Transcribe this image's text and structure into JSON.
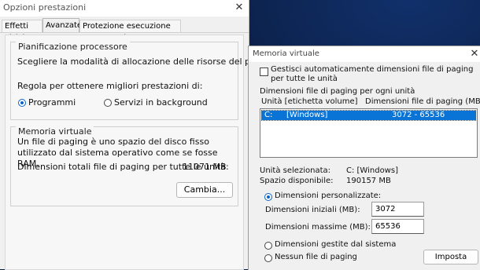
{
  "window1": {
    "title": "Opzioni prestazioni",
    "close": "✕",
    "tabs": [
      "Effetti visivi",
      "Avanzate",
      "Protezione esecuzione programmi"
    ],
    "processor": {
      "title": "Pianificazione processore",
      "description": "Scegliere la modalità di allocazione delle risorse del processore.",
      "adjust_label": "Regola per ottenere migliori prestazioni di:",
      "option_programs": "Programmi",
      "option_services": "Servizi in background"
    },
    "virtual_memory": {
      "title": "Memoria virtuale",
      "description": "Un file di paging è uno spazio del disco fisso utilizzato dal sistema operativo come se fosse RAM.",
      "total_label": "Dimensioni totali file di paging per tutte le unità:",
      "total_value": "11071 MB",
      "change_button": "Cambia..."
    }
  },
  "window2": {
    "title": "Memoria virtuale",
    "close": "✕",
    "auto_manage_label": "Gestisci automaticamente dimensioni file di paging per tutte le unità",
    "auto_manage_checked": false,
    "paging_header": "Dimensioni file di paging per ogni unità",
    "col_drive": "Unità [etichetta volume]",
    "col_size": "Dimensioni file di paging (MB)",
    "drives": [
      {
        "drive": "C:",
        "label": "[Windows]",
        "size": "3072 - 65536"
      }
    ],
    "selected_drive_label": "Unità selezionata:",
    "selected_drive_value": "C:  [Windows]",
    "space_label": "Spazio disponibile:",
    "space_value": "190157 MB",
    "custom_size_label": "Dimensioni personalizzate:",
    "initial_label": "Dimensioni iniziali (MB):",
    "initial_value": "3072",
    "max_label": "Dimensioni massime (MB):",
    "max_value": "65536",
    "system_managed_label": "Dimensioni gestite dal sistema",
    "no_paging_label": "Nessun file di paging",
    "set_button": "Imposta"
  }
}
